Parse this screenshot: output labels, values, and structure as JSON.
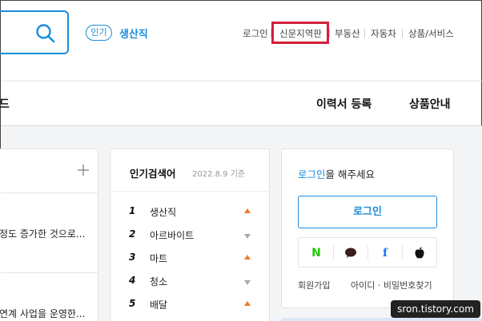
{
  "header": {
    "popular_badge": "인기",
    "popular_term": "생산직",
    "links": [
      "로그인",
      "신문지역판",
      "부동산",
      "자동차",
      "상품/서비스"
    ]
  },
  "nav": {
    "left_partial": "드",
    "resume": "이력서 등록",
    "products": "상품안내"
  },
  "news": {
    "item1": "정도 증가한 것으로...",
    "item2": "연계 사업을 운영한..."
  },
  "keywords": {
    "title": "인기검색어",
    "date": "2022.8.9 기준",
    "items": [
      {
        "rank": "1",
        "label": "생산직",
        "trend": "up"
      },
      {
        "rank": "2",
        "label": "아르바이트",
        "trend": "down"
      },
      {
        "rank": "3",
        "label": "마트",
        "trend": "up"
      },
      {
        "rank": "4",
        "label": "청소",
        "trend": "down"
      },
      {
        "rank": "5",
        "label": "배달",
        "trend": "up"
      }
    ]
  },
  "login": {
    "prompt_accent": "로그인",
    "prompt_rest": "을 해주세요",
    "button": "로그인",
    "social": [
      "N",
      "f"
    ],
    "signup": "회원가입",
    "find": "아이디 · 비밀번호찾기"
  },
  "watermark": "sron.tistory.com",
  "colors": {
    "accent": "#1b8cdc",
    "highlight": "#d21f3c",
    "up": "#f07a2b",
    "down": "#a9a9a9"
  }
}
